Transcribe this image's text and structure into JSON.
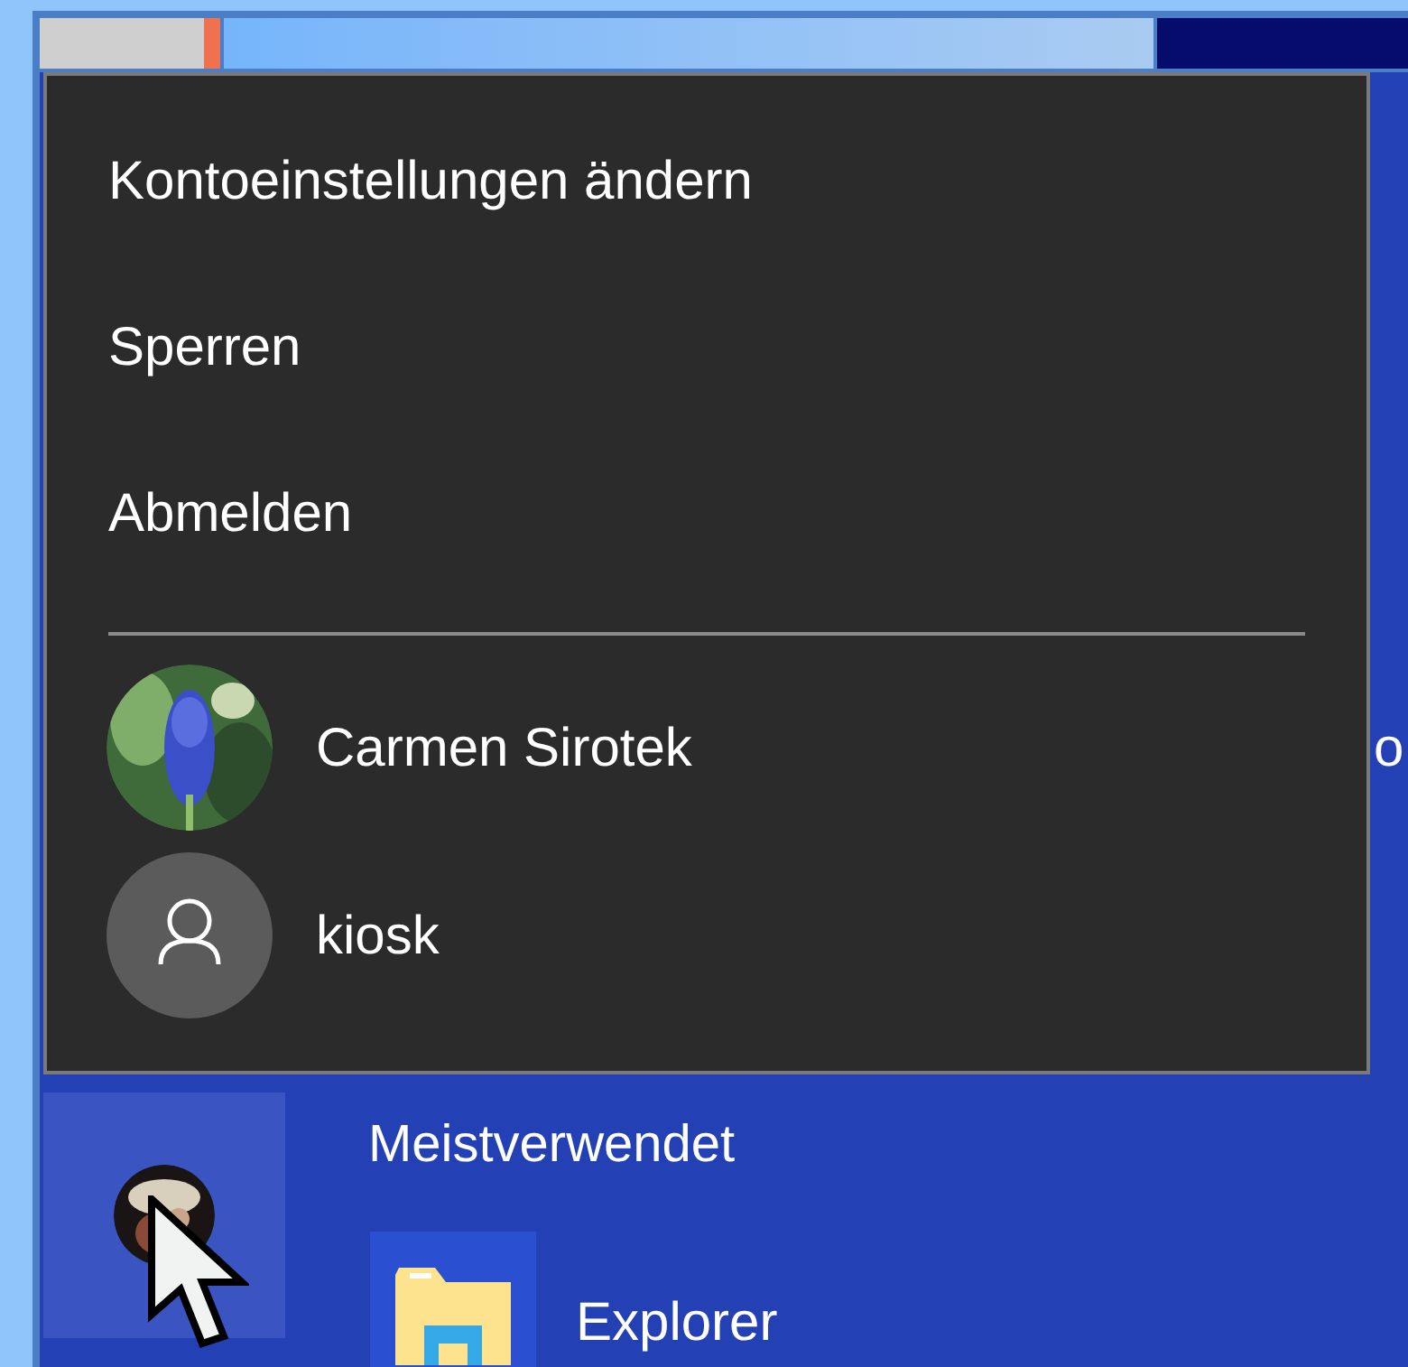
{
  "account_menu": {
    "items": [
      {
        "label": "Kontoeinstellungen ändern"
      },
      {
        "label": "Sperren"
      },
      {
        "label": "Abmelden"
      }
    ],
    "users": [
      {
        "name": "Carmen Sirotek"
      },
      {
        "name": "kiosk",
        "kind": "generic"
      }
    ]
  },
  "background_text": "o",
  "start_menu": {
    "section_title": "Meistverwendet",
    "apps": [
      {
        "label": "Explorer"
      }
    ]
  }
}
